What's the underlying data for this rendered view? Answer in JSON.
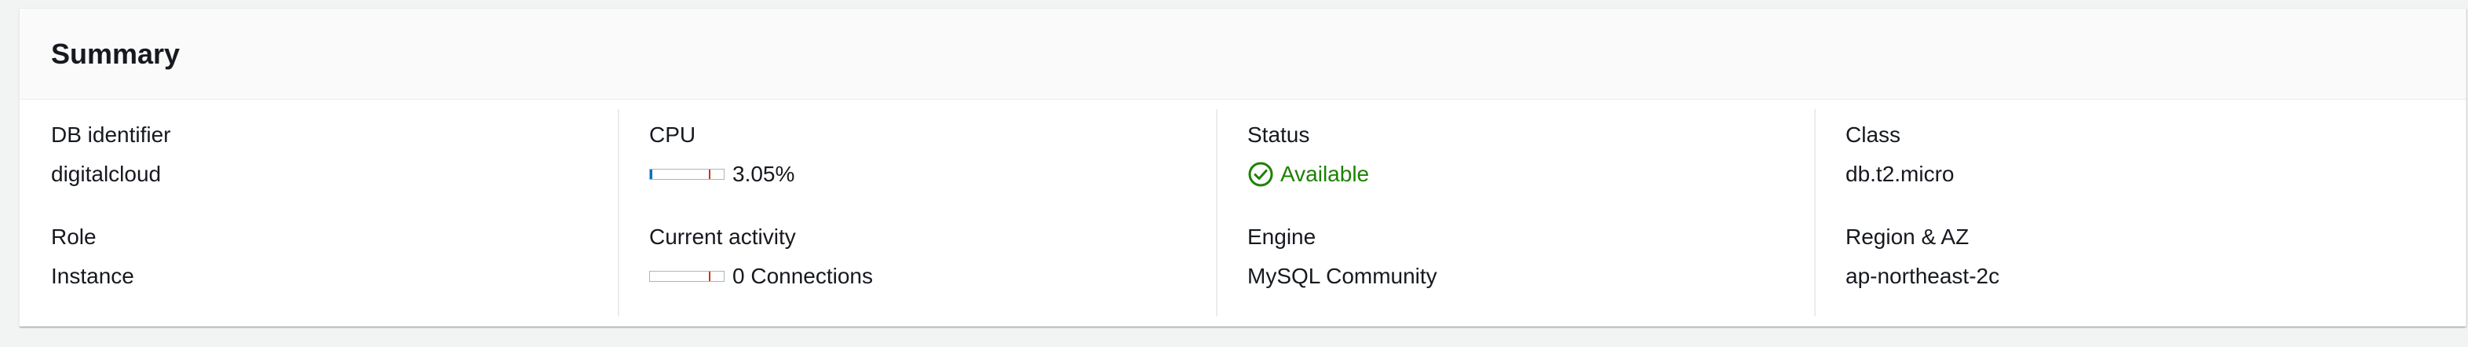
{
  "summary": {
    "title": "Summary",
    "fields": {
      "db_identifier": {
        "label": "DB identifier",
        "value": "digitalcloud"
      },
      "role": {
        "label": "Role",
        "value": "Instance"
      },
      "cpu": {
        "label": "CPU",
        "value": "3.05%",
        "fill_percent": 3.05
      },
      "current_activity": {
        "label": "Current activity",
        "value": "0 Connections",
        "fill_percent": 0
      },
      "status": {
        "label": "Status",
        "value": "Available",
        "icon": "check-circle-icon",
        "color": "#1d8102"
      },
      "engine": {
        "label": "Engine",
        "value": "MySQL Community"
      },
      "class": {
        "label": "Class",
        "value": "db.t2.micro"
      },
      "region_az": {
        "label": "Region & AZ",
        "value": "ap-northeast-2c"
      }
    }
  }
}
